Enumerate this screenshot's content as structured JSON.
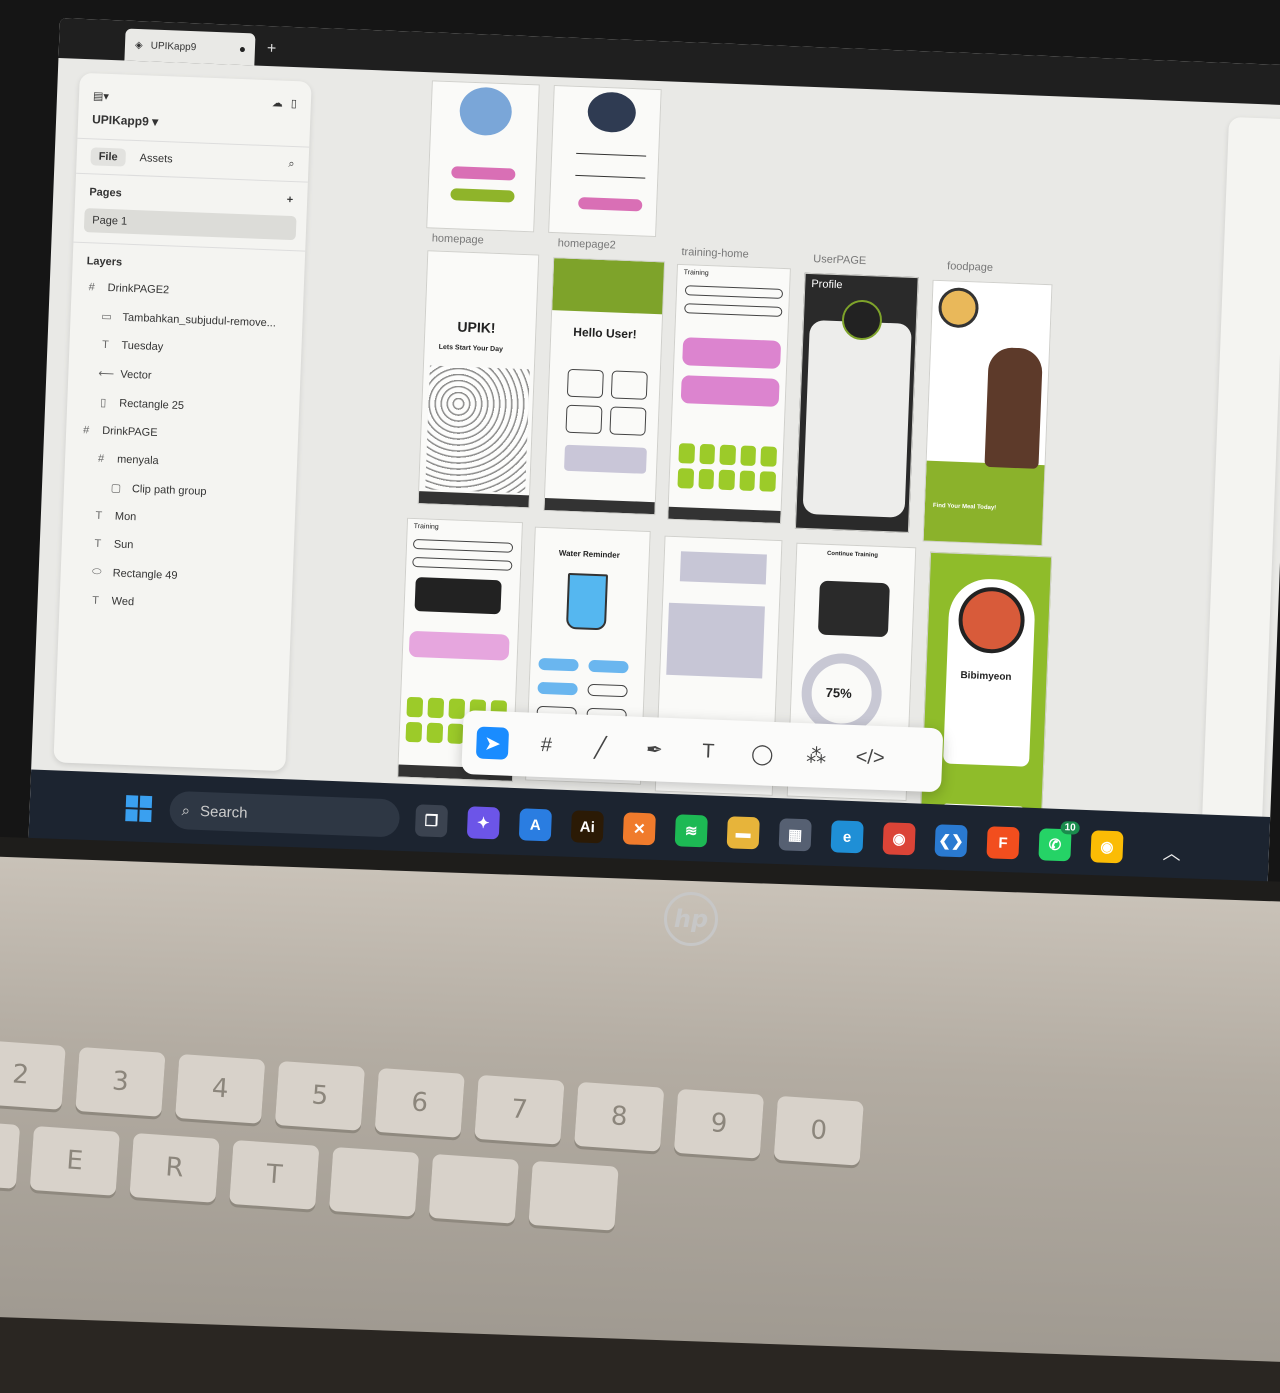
{
  "tab": {
    "title": "UPIKapp9"
  },
  "left_panel": {
    "project_name": "UPIKapp9",
    "tabs": [
      "File",
      "Assets"
    ],
    "pages_label": "Pages",
    "page_item": "Page 1",
    "layers_label": "Layers",
    "layers": [
      {
        "icon": "#",
        "label": "DrinkPAGE2",
        "indent": 0
      },
      {
        "icon": "▭",
        "label": "Tambahkan_subjudul-remove...",
        "indent": 1
      },
      {
        "icon": "T",
        "label": "Tuesday",
        "indent": 1
      },
      {
        "icon": "⟵",
        "label": "Vector",
        "indent": 1
      },
      {
        "icon": "▯",
        "label": "Rectangle 25",
        "indent": 1
      },
      {
        "icon": "#",
        "label": "DrinkPAGE",
        "indent": 0
      },
      {
        "icon": "#",
        "label": "menyala",
        "indent": 1
      },
      {
        "icon": "▢",
        "label": "Clip path group",
        "indent": 2
      },
      {
        "icon": "T",
        "label": "Mon",
        "indent": 1
      },
      {
        "icon": "T",
        "label": "Sun",
        "indent": 1
      },
      {
        "icon": "⬭",
        "label": "Rectangle 49",
        "indent": 1
      },
      {
        "icon": "T",
        "label": "Wed",
        "indent": 1
      }
    ]
  },
  "canvas": {
    "frame_labels": [
      "homepage",
      "homepage2",
      "training-home",
      "UserPAGE",
      "foodpage"
    ],
    "texts": {
      "upik_title": "UPIK!",
      "upik_sub": "Lets Start Your Day",
      "hello": "Hello User!",
      "training": "Training",
      "profile": "Profile",
      "find_meal": "Find Your Meal Today!",
      "training2": "Training",
      "water": "Water Reminder",
      "percent": "75%",
      "dish": "Bibimyeon",
      "continue": "Continue Training"
    }
  },
  "toolbar": {
    "tools": [
      {
        "name": "move-tool",
        "glyph": "➤"
      },
      {
        "name": "frame-tool",
        "glyph": "#"
      },
      {
        "name": "line-tool",
        "glyph": "╱"
      },
      {
        "name": "pen-tool",
        "glyph": "✒"
      },
      {
        "name": "text-tool",
        "glyph": "T"
      },
      {
        "name": "comment-tool",
        "glyph": "◯"
      },
      {
        "name": "components-tool",
        "glyph": "⁂"
      },
      {
        "name": "dev-mode-tool",
        "glyph": "</>"
      }
    ]
  },
  "taskbar": {
    "search_placeholder": "Search",
    "whatsapp_badge": "10",
    "apps": [
      {
        "name": "task-view-icon",
        "glyph": "❐",
        "color": "#3b4350"
      },
      {
        "name": "copilot-icon",
        "glyph": "✦",
        "color": "#6c55e8"
      },
      {
        "name": "app-a-icon",
        "glyph": "A",
        "color": "#2a7de1"
      },
      {
        "name": "illustrator-icon",
        "glyph": "Ai",
        "color": "#2b1a05"
      },
      {
        "name": "xampp-icon",
        "glyph": "✕",
        "color": "#f07b2c"
      },
      {
        "name": "spotify-icon",
        "glyph": "≋",
        "color": "#1db954"
      },
      {
        "name": "file-explorer-icon",
        "glyph": "▬",
        "color": "#e7b43a"
      },
      {
        "name": "calculator-icon",
        "glyph": "▦",
        "color": "#566072"
      },
      {
        "name": "edge-icon",
        "glyph": "e",
        "color": "#1f8fd6"
      },
      {
        "name": "chrome-icon",
        "glyph": "◉",
        "color": "#db4437"
      },
      {
        "name": "vscode-icon",
        "glyph": "❮❯",
        "color": "#2a7ad1"
      },
      {
        "name": "figma-icon",
        "glyph": "F",
        "color": "#f24e1e"
      },
      {
        "name": "whatsapp-icon",
        "glyph": "✆",
        "color": "#25d366"
      },
      {
        "name": "chrome-profile-icon",
        "glyph": "◉",
        "color": "#fbbc05"
      }
    ]
  }
}
